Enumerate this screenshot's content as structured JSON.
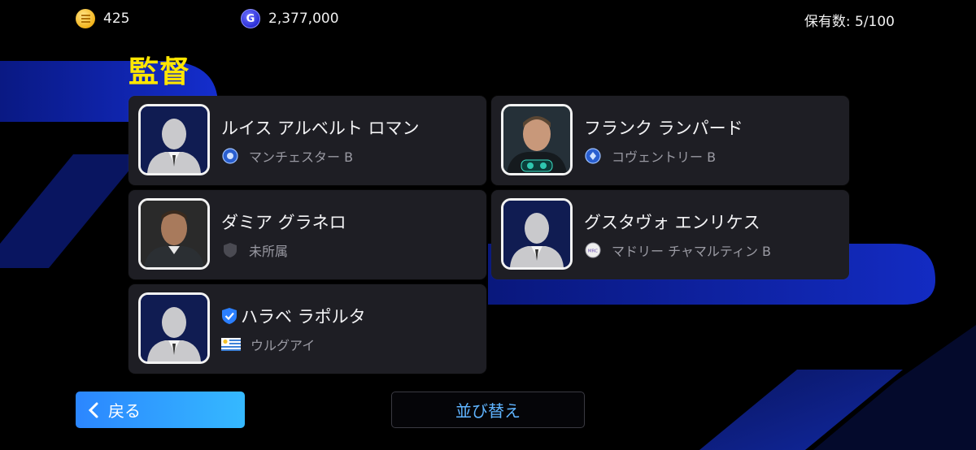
{
  "header": {
    "coins": "425",
    "gp": "2,377,000",
    "holdings": "保有数: 5/100",
    "coin_icon": "coin-icon",
    "gp_icon": "gp-icon",
    "gp_letter": "G"
  },
  "page_title": "監督",
  "managers": [
    {
      "name": "ルイス アルベルト ロマン",
      "team": "マンチェスター B",
      "badge": "club-crest-blue",
      "portrait": "silhouette"
    },
    {
      "name": "フランク ランパード",
      "team": "コヴェントリー B",
      "badge": "club-crest-blue",
      "portrait": "photo"
    },
    {
      "name": "ダミア グラネロ",
      "team": "未所属",
      "badge": "shield-gray",
      "portrait": "photo"
    },
    {
      "name": "グスタヴォ エンリケス",
      "team": "マドリー チャマルティン B",
      "badge": "club-crest-white",
      "badge_text": "MRC",
      "portrait": "silhouette"
    },
    {
      "name": "ハラベ ラポルタ",
      "team": "ウルグアイ",
      "badge": "flag-uruguay",
      "portrait": "silhouette",
      "verified": true
    }
  ],
  "buttons": {
    "back": "戻る",
    "sort": "並び替え"
  },
  "colors": {
    "title": "#ffe600",
    "accent_blue": "#2b86ff",
    "card_bg": "#1e1e24"
  }
}
